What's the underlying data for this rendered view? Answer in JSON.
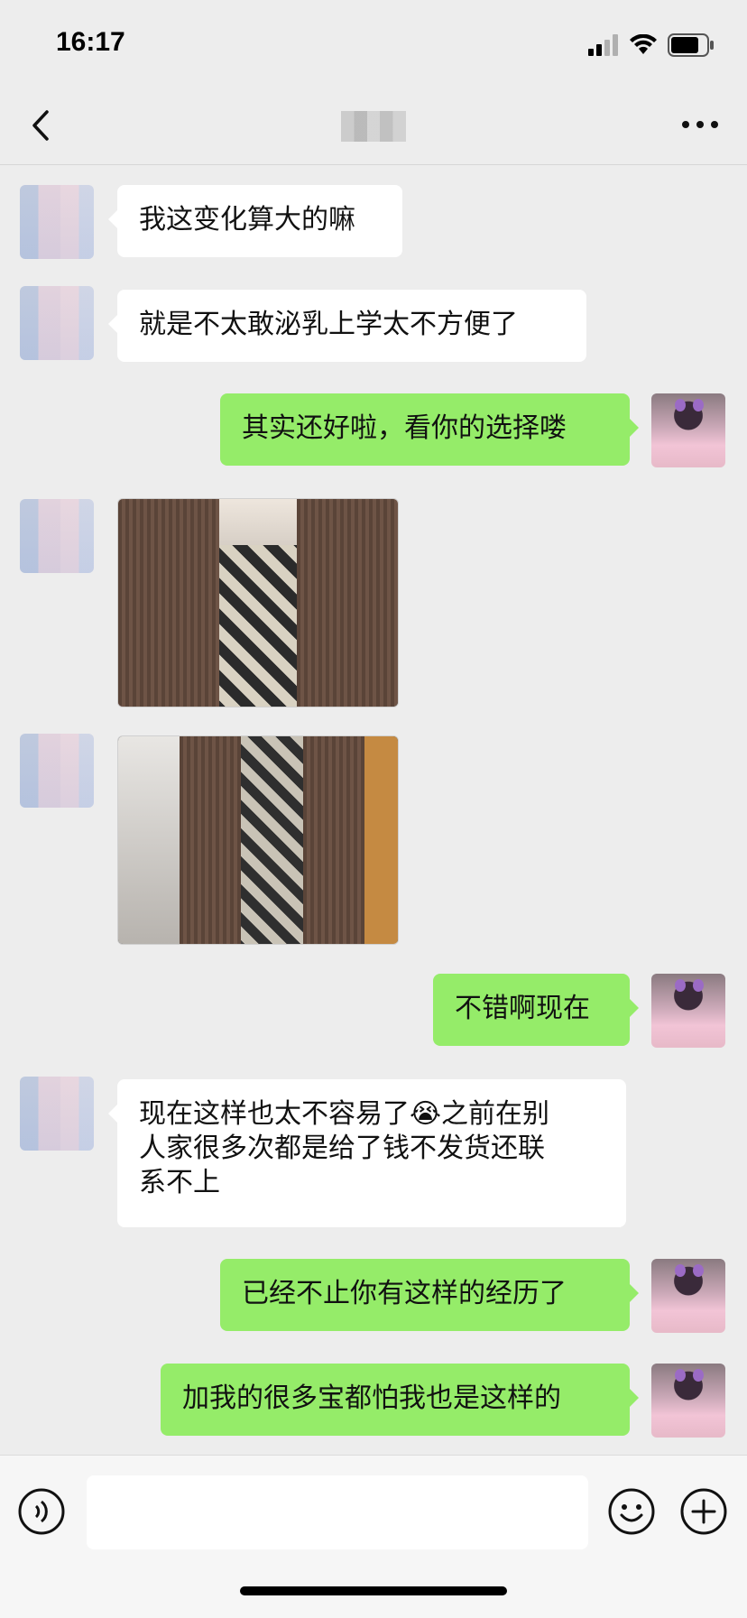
{
  "status_bar": {
    "time": "16:17"
  },
  "nav": {
    "title": ""
  },
  "messages": [
    {
      "side": "in",
      "type": "text",
      "text": "我这变化算大的嘛"
    },
    {
      "side": "in",
      "type": "text",
      "text": "就是不太敢泌乳上学太不方便了"
    },
    {
      "side": "out",
      "type": "text",
      "text": "其实还好啦，看你的选择喽"
    },
    {
      "side": "in",
      "type": "image"
    },
    {
      "side": "in",
      "type": "image"
    },
    {
      "side": "out",
      "type": "text",
      "text": "不错啊现在"
    },
    {
      "side": "in",
      "type": "text",
      "text": "现在这样也太不容易了😭之前在别\n人家很多次都是给了钱不发货还联\n系不上"
    },
    {
      "side": "out",
      "type": "text",
      "text": "已经不止你有这样的经历了"
    },
    {
      "side": "out",
      "type": "text",
      "text": "加我的很多宝都怕我也是这样的"
    }
  ],
  "input_bar": {
    "value": ""
  },
  "colors": {
    "background": "#ededed",
    "outgoing_bubble": "#95ec69",
    "incoming_bubble": "#ffffff"
  },
  "icons": [
    "signal-icon",
    "wifi-icon",
    "battery-icon",
    "back-icon",
    "more-icon",
    "voice-icon",
    "emoji-icon",
    "plus-icon"
  ]
}
